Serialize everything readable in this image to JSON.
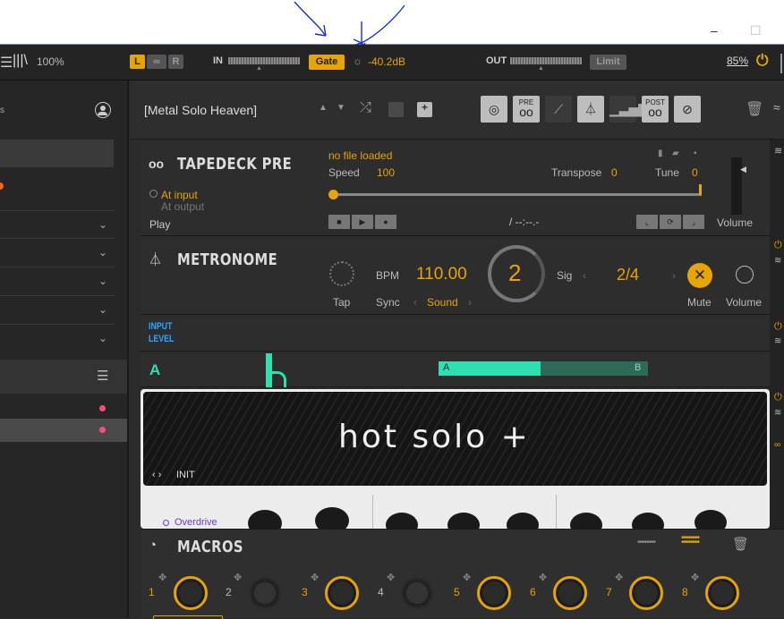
{
  "topbar": {
    "zoom_percent": "100%",
    "ch_left": "L",
    "ch_link": "∞",
    "ch_right": "R",
    "in_label": "IN",
    "gate_label": "Gate",
    "threshold": "-40.2dB",
    "out_label": "OUT",
    "limit_label": "Limit",
    "cpu_percent": "85%"
  },
  "header": {
    "preset_name": "[Metal Solo Heaven]",
    "pre_label": "PRE",
    "post_label": "POST"
  },
  "tapedeck": {
    "title": "TAPEDECK PRE",
    "file_status": "no file loaded",
    "speed_label": "Speed",
    "speed_value": "100",
    "transpose_label": "Transpose",
    "transpose_value": "0",
    "tune_label": "Tune",
    "tune_value": "0",
    "at_input": "At input",
    "at_output": "At output",
    "play_label": "Play",
    "time": "/ --:--.-",
    "volume_label": "Volume"
  },
  "metronome": {
    "title": "METRONOME",
    "tap_label": "Tap",
    "bpm_label": "BPM",
    "bpm_value": "110.00",
    "sync_label": "Sync",
    "sound_label": "Sound",
    "beat": "2",
    "sig_label": "Sig",
    "sig_value": "2/4",
    "mute_label": "Mute",
    "volume_label": "Volume"
  },
  "input_level": {
    "line1": "INPUT",
    "line2": "LEVEL"
  },
  "ab": {
    "label": "A",
    "a": "A",
    "b": "B"
  },
  "amp": {
    "name": "hot solo +",
    "preset": "INIT",
    "mode": "Overdrive"
  },
  "macros": {
    "title": "MACROS",
    "numbers": [
      "1",
      "2",
      "3",
      "4",
      "5",
      "6",
      "7",
      "8"
    ]
  },
  "colors": {
    "accent": "#e8a400",
    "teal": "#2ee0b0",
    "blue": "#2aa8ff",
    "pink": "#ff4d7a"
  }
}
